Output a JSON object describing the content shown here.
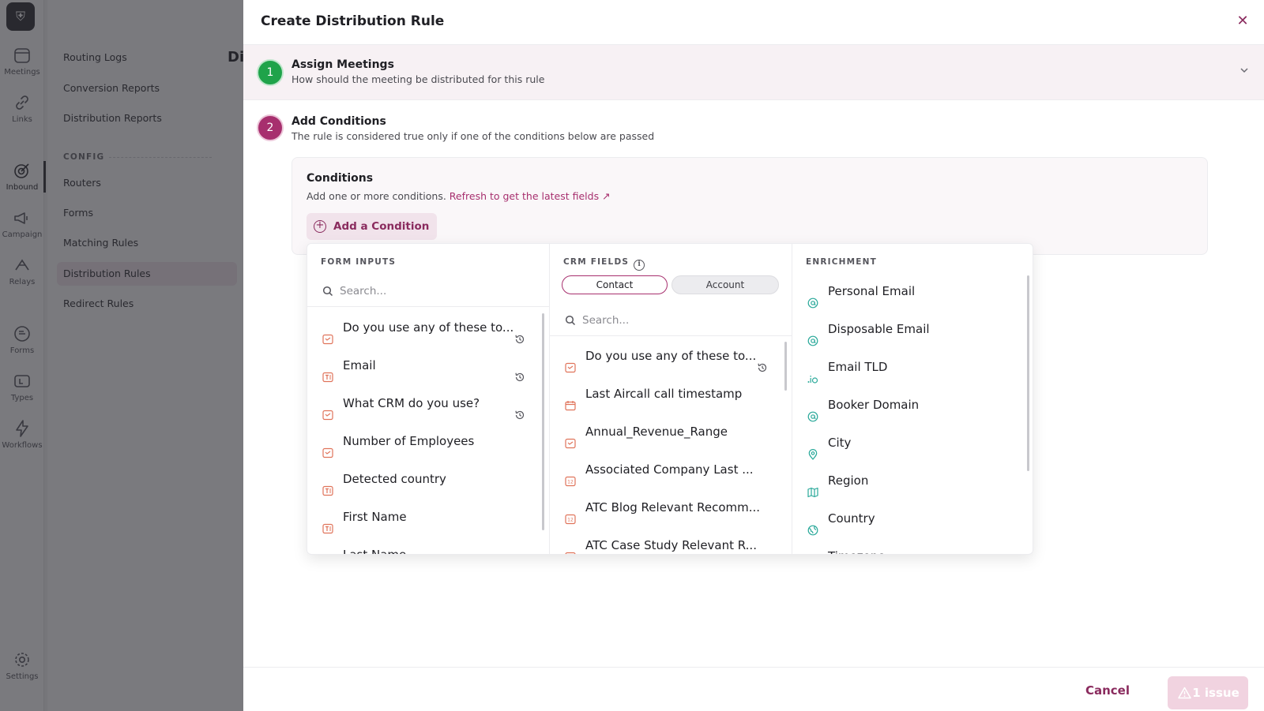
{
  "background": {
    "rail": [
      {
        "label": "Meetings",
        "icon": "calendar-icon"
      },
      {
        "label": "Links",
        "icon": "link-icon"
      },
      {
        "label": "Inbound",
        "icon": "target-icon"
      },
      {
        "label": "Campaign",
        "icon": "megaphone-icon"
      },
      {
        "label": "Relays",
        "icon": "relay-icon"
      },
      {
        "label": "Forms",
        "icon": "form-icon"
      },
      {
        "label": "Types",
        "icon": "types-icon"
      },
      {
        "label": "Workflows",
        "icon": "bolt-icon"
      },
      {
        "label": "Settings",
        "icon": "gear-icon"
      }
    ],
    "subnav": {
      "items_top": [
        "Routing Logs",
        "Conversion Reports",
        "Distribution Reports"
      ],
      "section_label": "CONFIG",
      "items_config": [
        "Routers",
        "Forms",
        "Matching Rules",
        "Distribution Rules",
        "Redirect Rules"
      ]
    },
    "main_title": "Di"
  },
  "drawer": {
    "title": "Create Distribution Rule",
    "step1": {
      "number": "1",
      "title": "Assign Meetings",
      "subtitle": "How should the meeting be distributed for this rule"
    },
    "step2": {
      "number": "2",
      "title": "Add Conditions",
      "subtitle": "The rule is considered true only if one of the conditions below are passed"
    },
    "conditions": {
      "title": "Conditions",
      "desc": "Add one or more conditions.",
      "refresh_link": "Refresh to get the latest fields ↗",
      "add_button": "Add a Condition"
    },
    "panel": {
      "form_inputs": {
        "heading": "FORM INPUTS",
        "search_placeholder": "Search...",
        "items": [
          {
            "label": "Do you use any of these to...",
            "icon": "picklist-icon",
            "history": true
          },
          {
            "label": "Email",
            "icon": "text-field-icon",
            "history": true
          },
          {
            "label": "What CRM do you use?",
            "icon": "picklist-icon",
            "history": true
          },
          {
            "label": "Number of Employees",
            "icon": "picklist-icon",
            "history": false
          },
          {
            "label": "Detected country",
            "icon": "text-field-icon",
            "history": false
          },
          {
            "label": "First Name",
            "icon": "text-field-icon",
            "history": false
          },
          {
            "label": "Last Name",
            "icon": "text-field-icon",
            "history": false
          }
        ]
      },
      "crm_fields": {
        "heading": "CRM FIELDS",
        "tabs": [
          "Contact",
          "Account"
        ],
        "search_placeholder": "Search...",
        "items": [
          {
            "label": "Do you use any of these to...",
            "icon": "picklist-icon",
            "history": true
          },
          {
            "label": "Last Aircall call timestamp",
            "icon": "date-icon",
            "history": false
          },
          {
            "label": "Annual_Revenue_Range",
            "icon": "picklist-icon",
            "history": false
          },
          {
            "label": "Associated Company Last ...",
            "icon": "number-icon",
            "history": false
          },
          {
            "label": "ATC Blog Relevant Recomm...",
            "icon": "number-icon",
            "history": false
          },
          {
            "label": "ATC Case Study Relevant R...",
            "icon": "number-icon",
            "history": false
          }
        ]
      },
      "enrichment": {
        "heading": "ENRICHMENT",
        "items": [
          {
            "label": "Personal Email",
            "icon": "at-icon"
          },
          {
            "label": "Disposable Email",
            "icon": "at-icon"
          },
          {
            "label": "Email TLD",
            "icon": "tld-icon"
          },
          {
            "label": "Booker Domain",
            "icon": "at-icon"
          },
          {
            "label": "City",
            "icon": "location-pin-icon"
          },
          {
            "label": "Region",
            "icon": "map-icon"
          },
          {
            "label": "Country",
            "icon": "globe-icon"
          },
          {
            "label": "Timezone",
            "icon": "clock-icon"
          }
        ]
      }
    },
    "footer": {
      "cancel": "Cancel",
      "issue": "1 issue"
    }
  },
  "colors": {
    "brand": "#a72f6e",
    "success": "#1fa34a",
    "orange_icon": "#e0735a",
    "teal_icon": "#2aa99a"
  }
}
